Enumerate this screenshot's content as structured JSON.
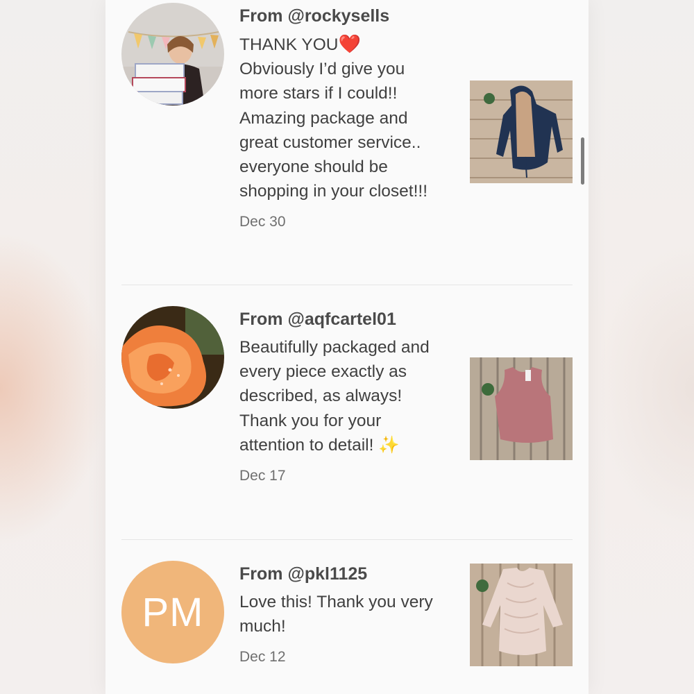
{
  "reviews": [
    {
      "from": "From @rockysells",
      "text_line1": "THANK YOU",
      "text_emoji": "❤️",
      "text": "Obviously I’d give you more stars if I could!! Amazing package and great customer service.. everyone should be shopping in your closet!!!",
      "date": "Dec 30",
      "product": "navy hooded jacket"
    },
    {
      "from": "From @aqfcartel01",
      "text": "Beautifully packaged and every piece exactly as described, as always! Thank you for your attention to detail! ✨",
      "date": "Dec 17",
      "product": "mauve tank top"
    },
    {
      "from": "From @pkl1125",
      "avatar_initials": "PM",
      "text": "Love this! Thank you very much!",
      "date": "Dec 12",
      "product": "cream knit sweater"
    }
  ],
  "colors": {
    "avatar_pm": "#f0b67a",
    "heart": "#e1202a"
  }
}
